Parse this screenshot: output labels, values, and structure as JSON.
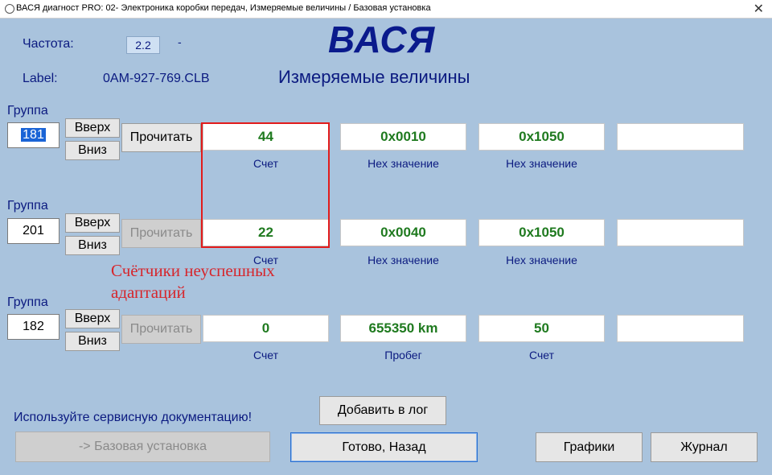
{
  "window": {
    "title": "ВАСЯ диагност PRO: 02- Электроника коробки передач,  Измеряемые величины / Базовая установка",
    "close_glyph": "✕"
  },
  "header": {
    "freq_label": "Частота:",
    "freq_value": "2.2",
    "freq_dash": "-",
    "label_label": "Label:",
    "label_value": "0AM-927-769.CLB",
    "brand": "ВАСЯ",
    "subtitle": "Измеряемые величины"
  },
  "groups": [
    {
      "label": "Группа",
      "number": "181",
      "up": "Вверх",
      "down": "Вниз",
      "read": "Прочитать",
      "fields": [
        {
          "value": "44",
          "caption": "Счет"
        },
        {
          "value": "0x0010",
          "caption": "Hex значение"
        },
        {
          "value": "0x1050",
          "caption": "Hex значение"
        },
        {
          "value": "",
          "caption": ""
        }
      ]
    },
    {
      "label": "Группа",
      "number": "201",
      "up": "Вверх",
      "down": "Вниз",
      "read": "Прочитать",
      "fields": [
        {
          "value": "22",
          "caption": "Счет"
        },
        {
          "value": "0x0040",
          "caption": "Hex значение"
        },
        {
          "value": "0x1050",
          "caption": "Hex значение"
        },
        {
          "value": "",
          "caption": ""
        }
      ]
    },
    {
      "label": "Группа",
      "number": "182",
      "up": "Вверх",
      "down": "Вниз",
      "read": "Прочитать",
      "fields": [
        {
          "value": "0",
          "caption": "Счет"
        },
        {
          "value": "655350 km",
          "caption": "Пробег"
        },
        {
          "value": "50",
          "caption": "Счет"
        },
        {
          "value": "",
          "caption": ""
        }
      ]
    }
  ],
  "annotation": {
    "line1": "Счётчики неуспешных",
    "line2": "адаптаций",
    "color": "#d6262c"
  },
  "footer": {
    "hint": "Используйте сервисную документацию!",
    "add_log": "Добавить в лог",
    "basic_setting": "-> Базовая установка",
    "done_back": "Готово, Назад",
    "graphs": "Графики",
    "journal": "Журнал"
  }
}
